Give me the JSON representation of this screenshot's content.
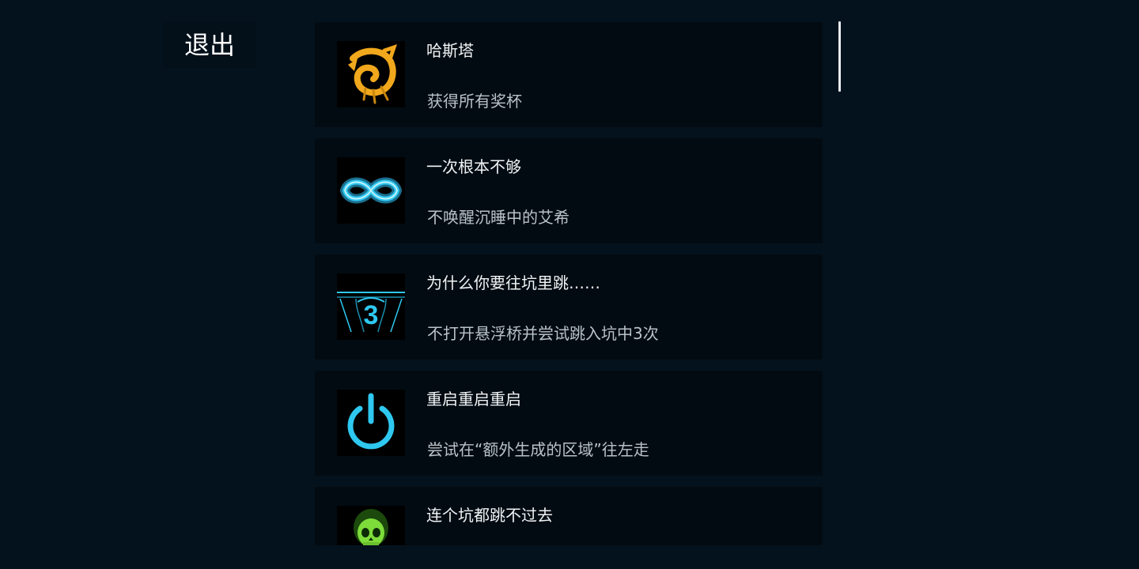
{
  "exit_label": "退出",
  "achievements": [
    {
      "title": "哈斯塔",
      "description": "获得所有奖杯",
      "icon": "golden-sigil-icon"
    },
    {
      "title": "一次根本不够",
      "description": "不唤醒沉睡中的艾希",
      "icon": "infinity-icon"
    },
    {
      "title": "为什么你要往坑里跳……",
      "description": "不打开悬浮桥并尝试跳入坑中3次",
      "icon": "bridge-three-icon",
      "icon_number": "3"
    },
    {
      "title": "重启重启重启",
      "description": "尝试在“额外生成的区域”往左走",
      "icon": "power-icon"
    },
    {
      "title": "连个坑都跳不过去",
      "description": "",
      "icon": "green-skull-icon"
    }
  ],
  "colors": {
    "background": "#04121d",
    "card": "#020b12",
    "title_text": "#f1f4f6",
    "desc_text": "#b9c2c8",
    "gold": "#f2a81c",
    "cyan": "#2ec8f0",
    "green": "#7ddc3a"
  }
}
